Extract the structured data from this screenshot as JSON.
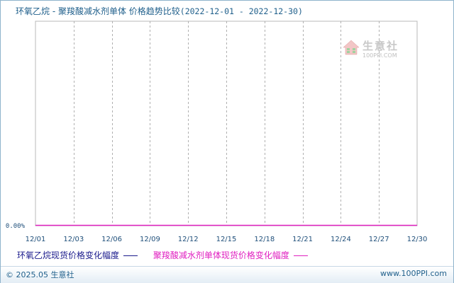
{
  "header": {
    "title": "环氧乙烷 - 聚羧酸减水剂单体 价格趋势比较",
    "range": "(2022-12-01 - 2022-12-30)"
  },
  "chart_data": {
    "type": "line",
    "title": "环氧乙烷 - 聚羧酸减水剂单体 价格趋势比较(2022-12-01 - 2022-12-30)",
    "x": [
      "12/01",
      "12/03",
      "12/06",
      "12/09",
      "12/12",
      "12/15",
      "12/18",
      "12/21",
      "12/24",
      "12/27",
      "12/30"
    ],
    "y_tick_labels": [
      "0.00%"
    ],
    "series": [
      {
        "name": "环氧乙烷现货价格变化幅度",
        "color": "#1a1a8c",
        "values": [
          0,
          0,
          0,
          0,
          0,
          0,
          0,
          0,
          0,
          0,
          0
        ]
      },
      {
        "name": "聚羧酸减水剂单体现货价格变化幅度",
        "color": "#e020c0",
        "values": [
          0,
          0,
          0,
          0,
          0,
          0,
          0,
          0,
          0,
          0,
          0
        ]
      }
    ],
    "grid": "vertical dashed",
    "legend_position": "bottom"
  },
  "legend": {
    "series1": "环氧乙烷现货价格变化幅度",
    "series2": "聚羧酸减水剂单体现货价格变化幅度"
  },
  "watermark": {
    "name": "生意社",
    "url": "100PPI.COM"
  },
  "footer": {
    "left": "© 2025.05 生意社",
    "right": "www.100PPI.com"
  },
  "colors": {
    "series1": "#1a1a8c",
    "series2": "#e020c0",
    "title": "#1f5f8b",
    "grid": "#b0b0b0"
  }
}
